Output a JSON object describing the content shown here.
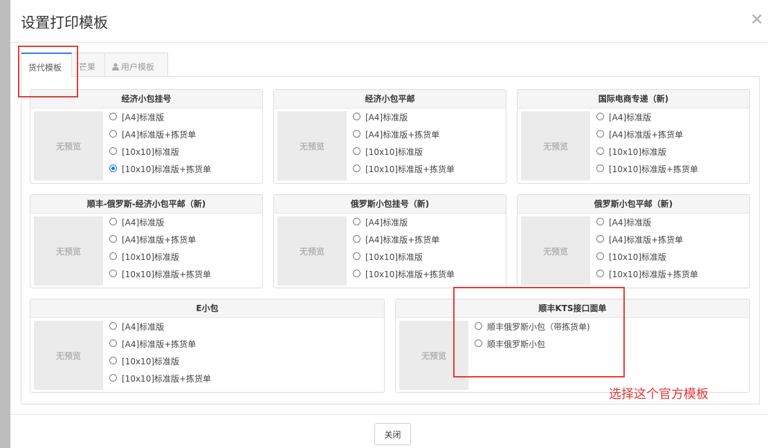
{
  "modal": {
    "title": "设置打印模板",
    "close_symbol": "×"
  },
  "tabs": [
    {
      "label": "货代模板",
      "active": true
    },
    {
      "label": "芒果",
      "active": false
    },
    {
      "label": "用户模板",
      "active": false,
      "icon": "user-icon"
    }
  ],
  "preview_text": "无预览",
  "panels": [
    {
      "title": "经济小包挂号",
      "options": [
        "[A4]标准版",
        "[A4]标准版+拣货单",
        "[10x10]标准版",
        "[10x10]标准版+拣货单"
      ],
      "selected": 3
    },
    {
      "title": "经济小包平邮",
      "options": [
        "[A4]标准版",
        "[A4]标准版+拣货单",
        "[10x10]标准版",
        "[10x10]标准版+拣货单"
      ],
      "selected": -1
    },
    {
      "title": "国际电商专递（新)",
      "options": [
        "[A4]标准版",
        "[A4]标准版+拣货单",
        "[10x10]标准版",
        "[10x10]标准版+拣货单"
      ],
      "selected": -1
    },
    {
      "title": "顺丰-俄罗斯-经济小包平邮（新)",
      "options": [
        "[A4]标准版",
        "[A4]标准版+拣货单",
        "[10x10]标准版",
        "[10x10]标准版+拣货单"
      ],
      "selected": -1
    },
    {
      "title": "俄罗斯小包挂号（新)",
      "options": [
        "[A4]标准版",
        "[A4]标准版+拣货单",
        "[10x10]标准版",
        "[10x10]标准版+拣货单"
      ],
      "selected": -1
    },
    {
      "title": "俄罗斯小包平邮（新)",
      "options": [
        "[A4]标准版",
        "[A4]标准版+拣货单",
        "[10x10]标准版",
        "[10x10]标准版+拣货单"
      ],
      "selected": -1
    },
    {
      "title": "E小包",
      "options": [
        "[A4]标准版",
        "[A4]标准版+拣货单",
        "[10x10]标准版",
        "[10x10]标准版+拣货单"
      ],
      "selected": -1
    },
    {
      "title": "顺丰KTS接口面单",
      "options": [
        "顺丰俄罗斯小包（带拣货单)",
        "顺丰俄罗斯小包"
      ],
      "selected": -1
    }
  ],
  "annotation": "选择这个官方模板",
  "footer": {
    "close_label": "关闭"
  },
  "colors": {
    "primary": "#2f7ed8",
    "annotation_red": "#e53935",
    "radio_checked": "#1a73e8"
  }
}
